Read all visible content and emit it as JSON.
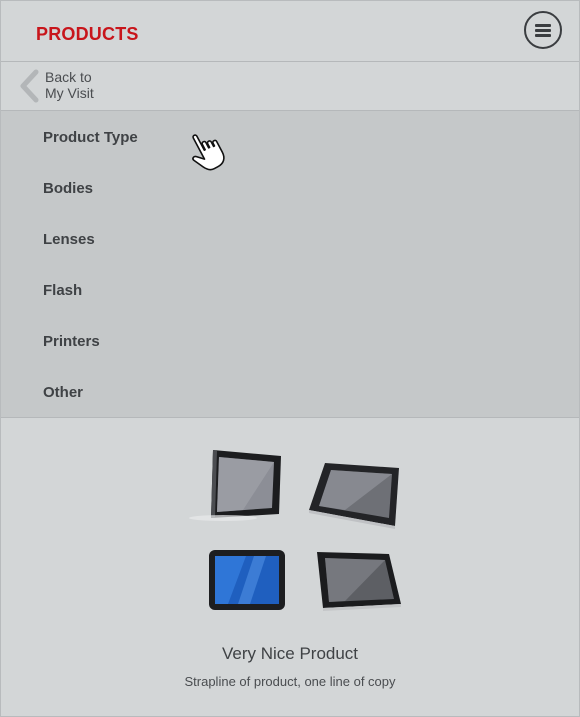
{
  "header": {
    "title": "PRODUCTS",
    "menu_icon": "hamburger-menu-icon"
  },
  "back": {
    "line1": "Back to",
    "line2": "My Visit",
    "icon": "chevron-left-icon"
  },
  "categories": [
    {
      "label": "Product Type"
    },
    {
      "label": "Bodies"
    },
    {
      "label": "Lenses"
    },
    {
      "label": "Flash"
    },
    {
      "label": "Printers"
    },
    {
      "label": "Other"
    }
  ],
  "product": {
    "name": "Very Nice Product",
    "strapline": "Strapline of product, one line of copy"
  },
  "colors": {
    "accent": "#c8151b",
    "background": "#d3d6d7",
    "menu_background": "#c5c8c9"
  }
}
